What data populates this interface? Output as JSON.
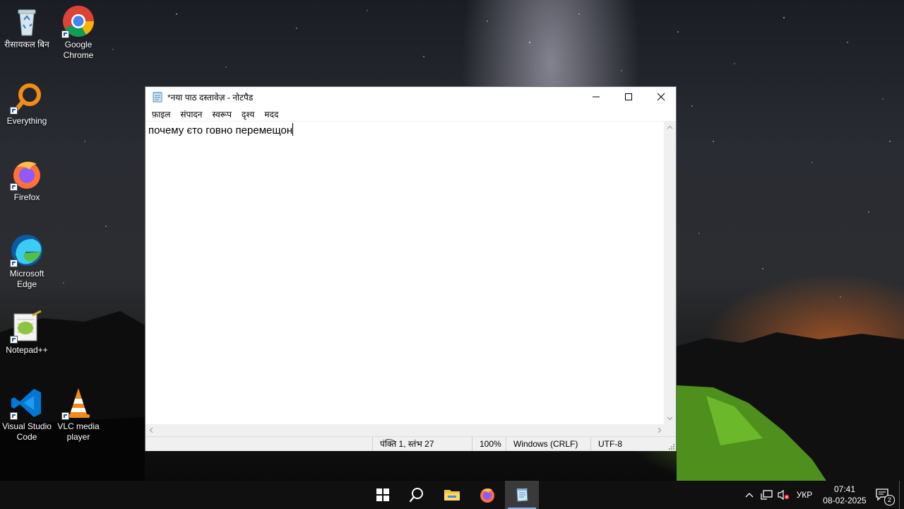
{
  "desktop": {
    "icons": [
      {
        "label": "रीसायकल बिन",
        "icon": "recycle-bin-icon"
      },
      {
        "label": "Google Chrome",
        "icon": "chrome-icon"
      },
      {
        "label": "Everything",
        "icon": "everything-search-icon"
      },
      {
        "label": "Firefox",
        "icon": "firefox-icon"
      },
      {
        "label": "Microsoft Edge",
        "icon": "edge-icon"
      },
      {
        "label": "Notepad++",
        "icon": "notepad-plus-plus-icon"
      },
      {
        "label": "Visual Studio Code",
        "icon": "vscode-icon"
      },
      {
        "label": "VLC media player",
        "icon": "vlc-icon"
      }
    ]
  },
  "notepad": {
    "title": "*नया पाठ दस्तावेज़ - नोटपैड",
    "menu": [
      "फ़ाइल",
      "संपादन",
      "स्वरूप",
      "दृश्य",
      "मदद"
    ],
    "content": "почему єто говно перемещон",
    "status": {
      "position": "पंक्ति 1, स्तंभ 27",
      "zoom": "100%",
      "line_ending": "Windows (CRLF)",
      "encoding": "UTF-8"
    }
  },
  "taskbar": {
    "apps": [
      "start-icon",
      "search-icon",
      "file-explorer-icon",
      "firefox-icon",
      "notepad-icon"
    ],
    "active_app": "notepad-icon",
    "language": "УКР",
    "time": "07:41",
    "date": "08-02-2025",
    "notification_count": "2"
  },
  "colors": {
    "taskbar": "#101010",
    "active_indicator": "#8ab4f8",
    "window_border": "#6b6b6b"
  }
}
